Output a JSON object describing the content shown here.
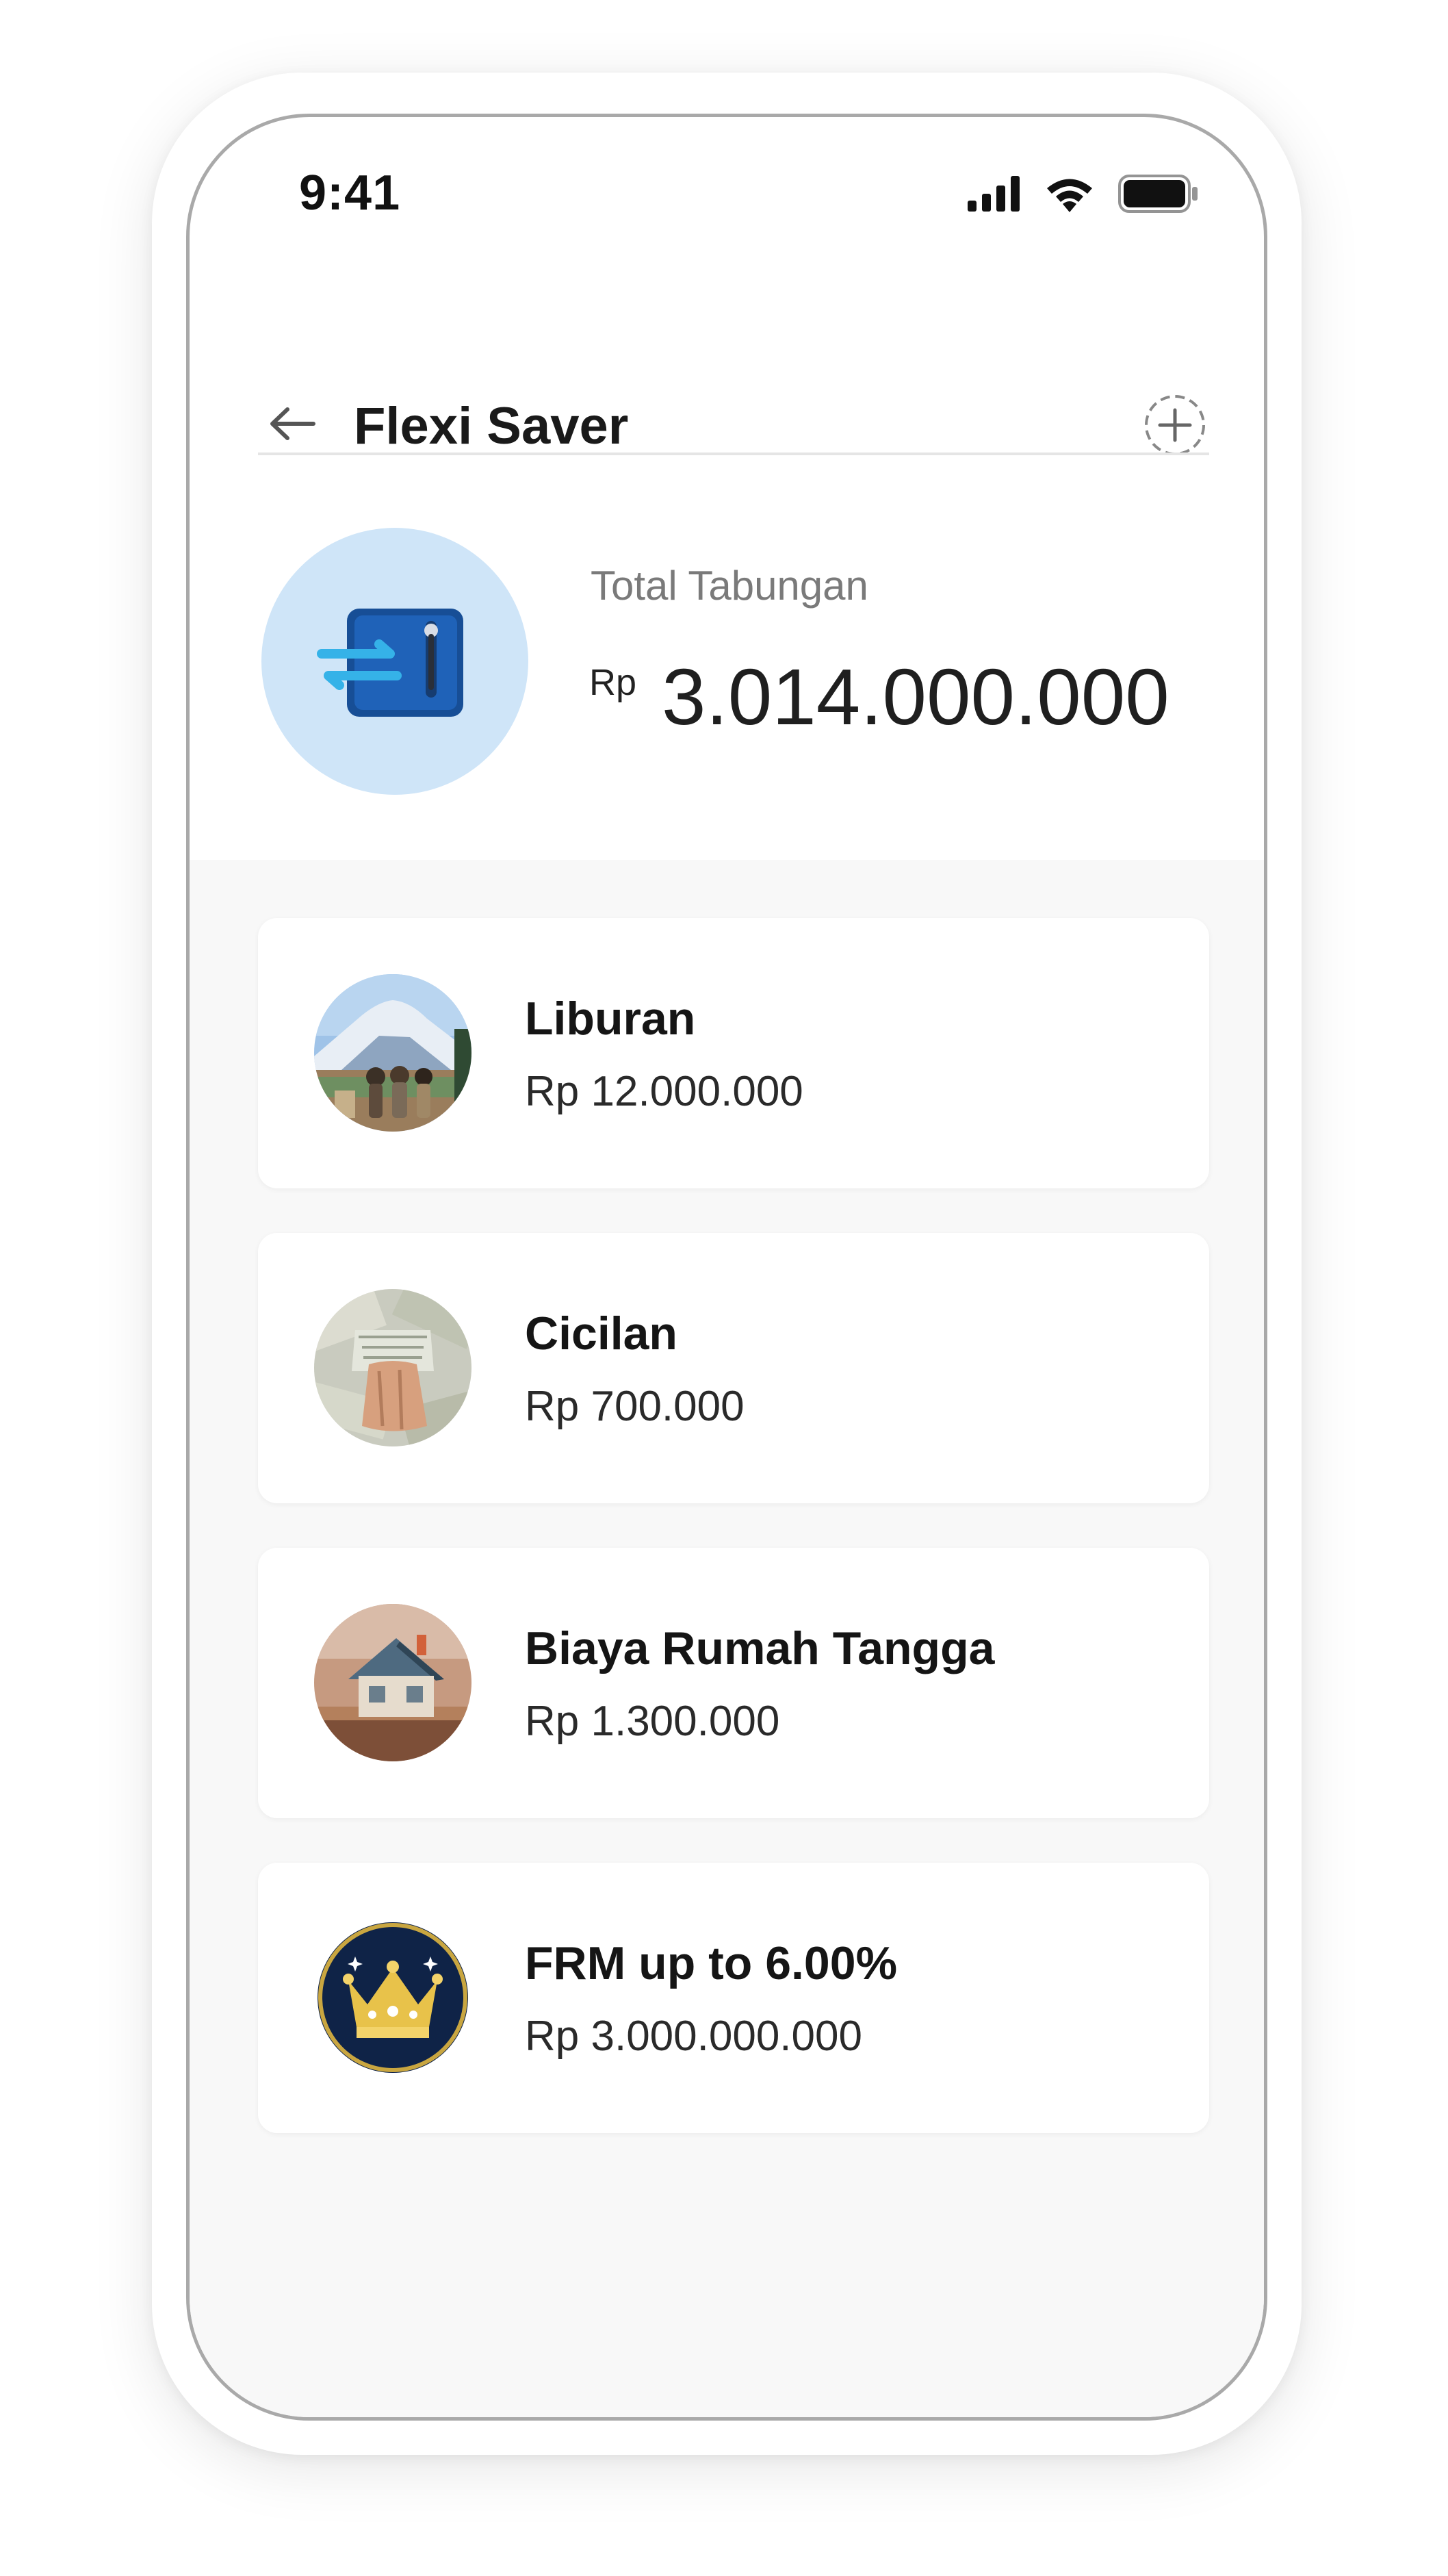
{
  "status_bar": {
    "time": "9:41",
    "signal_icon": "cellular-signal-icon",
    "wifi_icon": "wifi-icon",
    "battery_icon": "battery-icon"
  },
  "header": {
    "back_icon": "arrow-left-icon",
    "title": "Flexi Saver",
    "add_icon": "plus-circle-dashed-icon"
  },
  "summary": {
    "icon": "safe-vault-icon",
    "label": "Total Tabungan",
    "currency": "Rp",
    "amount": "3.014.000.000"
  },
  "pockets": [
    {
      "name": "Liburan",
      "amount": "Rp 12.000.000",
      "image": "mountain-travel-photo"
    },
    {
      "name": "Cicilan",
      "amount": "Rp 700.000",
      "image": "money-cash-photo"
    },
    {
      "name": "Biaya Rumah Tangga",
      "amount": "Rp 1.300.000",
      "image": "house-money-photo"
    },
    {
      "name": "FRM up to 6.00%",
      "amount": "Rp 3.000.000.000",
      "image": "gold-crown-icon"
    }
  ],
  "colors": {
    "accent_light_blue": "#cfe5f8",
    "vault_blue": "#1e5fb4",
    "crown_navy": "#0f2347",
    "crown_gold": "#e8c24a"
  }
}
